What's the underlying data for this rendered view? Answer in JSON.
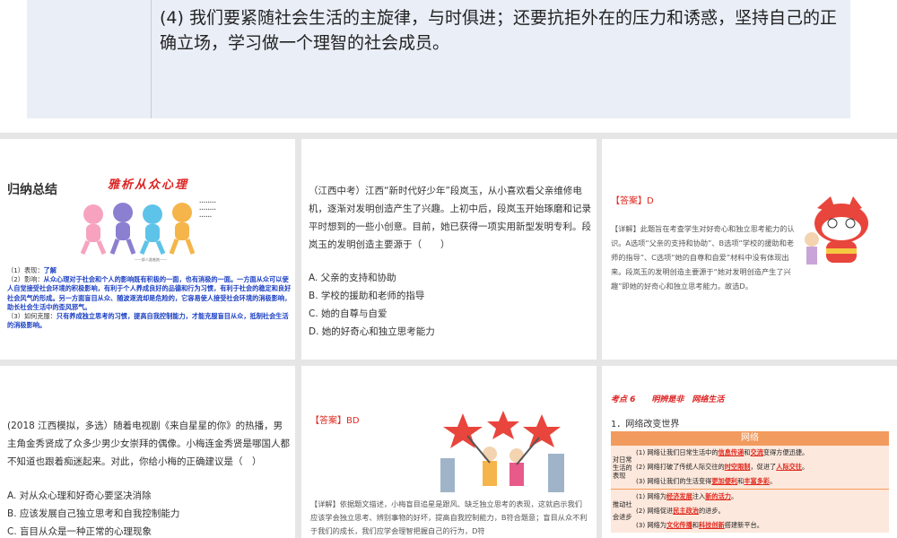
{
  "top_slide": {
    "text": "(4) 我们要紧随社会生活的主旋律，与时俱进；还要抗拒外在的压力和诱惑，坚持自己的正确立场，学习做一个理智的社会成员。"
  },
  "slide1": {
    "heading": "归纳总结",
    "graffiti_title": "雅析从众心理",
    "caption": "——群人跟着跑——",
    "lines": [
      {
        "label": "（1）表现：",
        "text": "了解"
      },
      {
        "label": "（2）影响：",
        "text": "从众心理对于社会和个人的影响既有积极的一面，也有消极的一面。一方面从众可以使人自觉接受社会环境的积极影响，有利于个人养成良好的品德和行为习惯，有利于社会的稳定和良好社会风气的形成。另一方面盲目从众、随波逐流却是危险的，它容易使人接受社会环境的消极影响，助长社会生活中的歪风邪气。"
      },
      {
        "label": "（3）如何克服：",
        "text": "只有养成独立思考的习惯，提高自我控制能力，才能克服盲目从众，抵制社会生活的消极影响。"
      }
    ]
  },
  "slide2": {
    "question": "（江西中考）江西“新时代好少年”段岚玉，从小喜欢看父亲维修电机，逐渐对发明创造产生了兴趣。上初中后，段岚玉开始琢磨和记录平时想到的一些小创意。目前，她已获得一项实用新型发明专利。段岚玉的发明创造主要源于（　　）",
    "options": [
      "A. 父亲的支持和协助",
      "B. 学校的援助和老师的指导",
      "C. 她的自尊与自爱",
      "D. 她的好奇心和独立思考能力"
    ]
  },
  "slide3": {
    "answer_label": "【答案】",
    "answer": "D",
    "explanation": "【详解】此题旨在考查学生对好奇心和独立思考能力的认识。A选项“父亲的支持和协助”、B选项“学校的援助和老师的指导”、C选项“她的自尊和自爱”材料中没有体现出来。段岚玉的发明创造主要源于“她对发明创造产生了兴趣”即她的好奇心和独立思考能力。故选D。"
  },
  "slide4": {
    "question": "(2018 江西模拟，多选）随着电视剧《来自星星的你》的热播，男主角金秀贤成了众多少男少女崇拜的偶像。小梅连金秀贤是哪国人都不知道也跟着痴迷起来。对此，你给小梅的正确建议是（　）",
    "options": [
      "A. 对从众心理和好奇心要坚决消除",
      "B. 应该发展自己独立思考和自我控制能力",
      "C. 盲目从众是一种正常的心理现象"
    ]
  },
  "slide5": {
    "answer_label": "【答案】",
    "answer": "BD",
    "explanation": "【详解】依据题文描述，小梅盲目追星是跟风、缺乏独立思考的表现，这就启示我们应该学会独立思考、辨别事物的好坏，提高自我控制能力，B符合题意；盲目从众不利于我们的成长，我们应学会理智把握自己的行为，D符"
  },
  "slide6": {
    "header": "考点 6　　明辨是非　网络生活",
    "subheading": "1．网络改变世界",
    "table_title": "网络",
    "groups": [
      {
        "label": "对日常生活的表现",
        "rows": [
          [
            "(1) 网络让我们日常生活中的",
            "信息传递",
            "和",
            "交流",
            "变得方便迅捷。",
            "",
            ""
          ],
          [
            "(2) 网络打破了传统人际交往的",
            "时空限制",
            "，促进了",
            "人际交往",
            "。",
            "",
            ""
          ],
          [
            "(3) 网络让我们的生活变得",
            "更加便利",
            "和",
            "丰富多彩",
            "。",
            "",
            ""
          ]
        ]
      },
      {
        "label": "推动社会进步",
        "rows": [
          [
            "(1) 网络为",
            "经济发展",
            "注入",
            "新的活力",
            "。",
            "",
            ""
          ],
          [
            "(2) 网络促进",
            "民主政治",
            "的进步。",
            "",
            "",
            "",
            ""
          ],
          [
            "(3) 网络为",
            "文化传播",
            "和",
            "科技创新",
            "搭建新平台。",
            "",
            ""
          ]
        ]
      }
    ]
  }
}
